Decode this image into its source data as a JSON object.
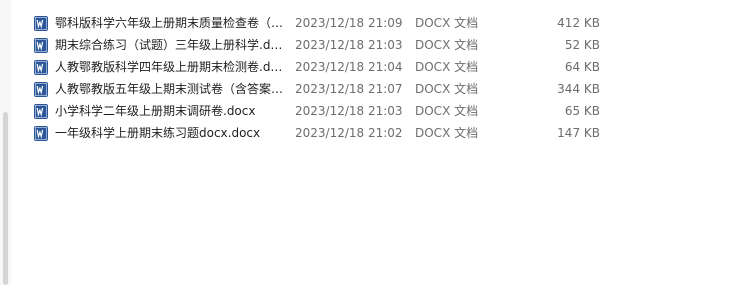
{
  "files": [
    {
      "name": "鄂科版科学六年级上册期末质量检查卷（…",
      "date": "2023/12/18 21:09",
      "type": "DOCX 文档",
      "size": "412 KB",
      "icon": "word-document-icon"
    },
    {
      "name": "期末综合练习（试题）三年级上册科学.d…",
      "date": "2023/12/18 21:03",
      "type": "DOCX 文档",
      "size": "52 KB",
      "icon": "word-document-icon"
    },
    {
      "name": "人教鄂教版科学四年级上册期末检测卷.d…",
      "date": "2023/12/18 21:04",
      "type": "DOCX 文档",
      "size": "64 KB",
      "icon": "word-document-icon"
    },
    {
      "name": "人教鄂教版五年级上期末测试卷（含答案…",
      "date": "2023/12/18 21:07",
      "type": "DOCX 文档",
      "size": "344 KB",
      "icon": "word-document-icon"
    },
    {
      "name": "小学科学二年级上册期末调研卷.docx",
      "date": "2023/12/18 21:03",
      "type": "DOCX 文档",
      "size": "65 KB",
      "icon": "word-document-icon"
    },
    {
      "name": "一年级科学上册期末练习题docx.docx",
      "date": "2023/12/18 21:02",
      "type": "DOCX 文档",
      "size": "147 KB",
      "icon": "word-document-icon"
    }
  ],
  "colors": {
    "icon_blue": "#2b579a",
    "icon_light": "#ffffff",
    "text": "#1f1f1f",
    "secondary_text": "#6d6d6d"
  }
}
